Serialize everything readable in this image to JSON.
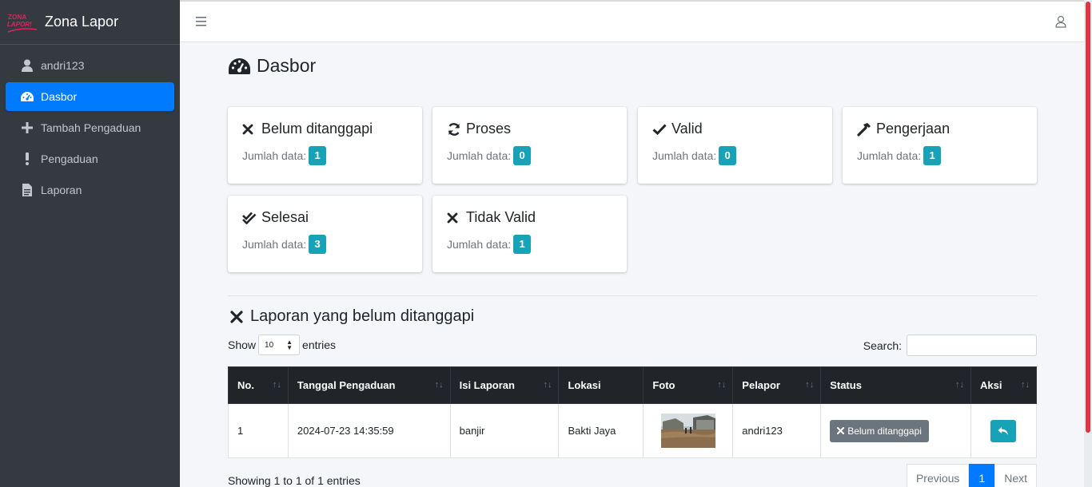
{
  "brand": {
    "logo_line1": "ZONA",
    "logo_line2": "LAPOR!",
    "name": "Zona Lapor",
    "accent": "#e0245e"
  },
  "sidebar": {
    "user": "andri123",
    "items": [
      {
        "label": "Dasbor",
        "icon": "dashboard-icon",
        "active": true
      },
      {
        "label": "Tambah Pengaduan",
        "icon": "plus-icon"
      },
      {
        "label": "Pengaduan",
        "icon": "exclamation-icon"
      },
      {
        "label": "Laporan",
        "icon": "file-icon"
      }
    ]
  },
  "page": {
    "title": "Dasbor"
  },
  "cards": [
    {
      "title": "Belum ditanggapi",
      "meta": "Jumlah data:",
      "count": "1",
      "icon": "times-icon"
    },
    {
      "title": "Proses",
      "meta": "Jumlah data:",
      "count": "0",
      "icon": "sync-icon"
    },
    {
      "title": "Valid",
      "meta": "Jumlah data:",
      "count": "0",
      "icon": "check-icon"
    },
    {
      "title": "Pengerjaan",
      "meta": "Jumlah data:",
      "count": "1",
      "icon": "hammer-icon"
    },
    {
      "title": "Selesai",
      "meta": "Jumlah data:",
      "count": "3",
      "icon": "check-double-icon"
    },
    {
      "title": "Tidak Valid",
      "meta": "Jumlah data:",
      "count": "1",
      "icon": "times-icon"
    }
  ],
  "section": {
    "title": "Laporan yang belum ditanggapi"
  },
  "datatable": {
    "show_label": "Show",
    "page_size": "10",
    "entries_label": "entries",
    "search_label": "Search:",
    "search_value": "",
    "columns": [
      "No.",
      "Tanggal Pengaduan",
      "Isi Laporan",
      "Lokasi",
      "Foto",
      "Pelapor",
      "Status",
      "Aksi"
    ],
    "rows": [
      {
        "no": "1",
        "tanggal": "2024-07-23 14:35:59",
        "isi": "banjir",
        "lokasi": "Bakti Jaya",
        "pelapor": "andri123",
        "status": "Belum ditanggapi"
      }
    ],
    "info": "Showing 1 to 1 of 1 entries",
    "pager": {
      "prev": "Previous",
      "current": "1",
      "next": "Next"
    }
  },
  "colors": {
    "primary": "#007bff",
    "info": "#17a2b8",
    "sidebar": "#343a40",
    "dark": "#212529"
  }
}
